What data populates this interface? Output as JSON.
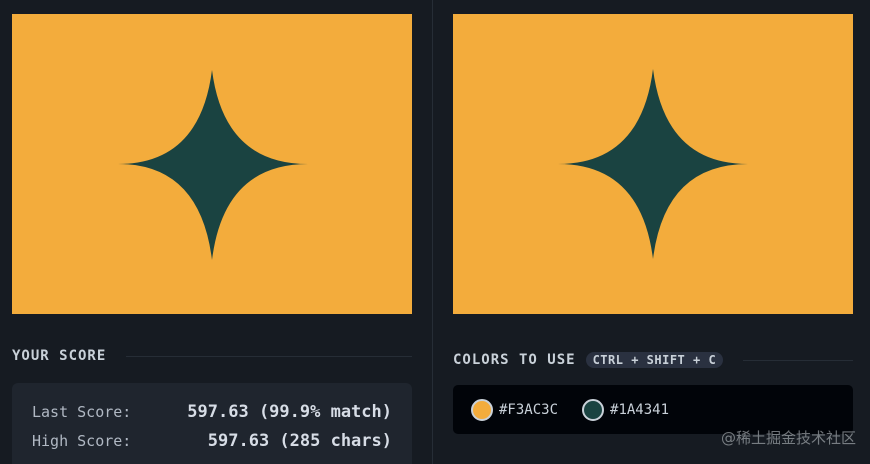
{
  "colors": {
    "background": "#F3AC3C",
    "shape": "#1A4341"
  },
  "shape_icon": "four-point-star-icon",
  "score": {
    "title": "YOUR SCORE",
    "last_label": "Last Score:",
    "last_value": "597.63 (99.9% match)",
    "high_label": "High Score:",
    "high_value": "597.63 (285 chars)"
  },
  "palette": {
    "title": "COLORS TO USE",
    "shortcut": "CTRL + SHIFT + C",
    "swatches": [
      {
        "hex": "#F3AC3C",
        "color": "#F3AC3C"
      },
      {
        "hex": "#1A4341",
        "color": "#1A4341"
      }
    ]
  },
  "watermark": "@稀土掘金技术社区"
}
